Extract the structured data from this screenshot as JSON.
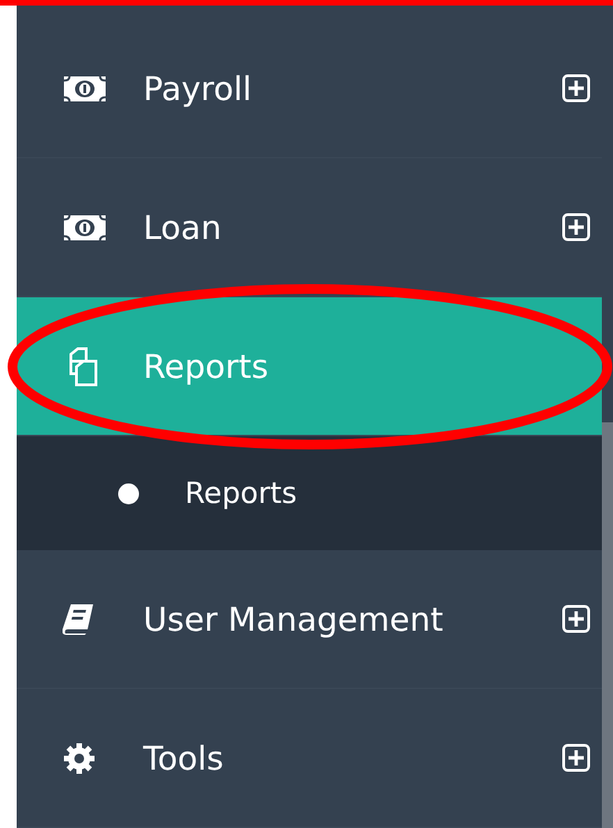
{
  "sidebar": {
    "items": [
      {
        "label": "Payroll",
        "selected": false,
        "expanded": false,
        "circled": false
      },
      {
        "label": "Loan",
        "selected": false,
        "expanded": false,
        "circled": false
      },
      {
        "label": "Reports",
        "selected": true,
        "expanded": true,
        "circled": true,
        "children": [
          {
            "label": "Reports",
            "selected": false
          }
        ]
      },
      {
        "label": "User Management",
        "selected": false,
        "expanded": false,
        "circled": false
      },
      {
        "label": "Tools",
        "selected": false,
        "expanded": false,
        "circled": false
      }
    ]
  }
}
